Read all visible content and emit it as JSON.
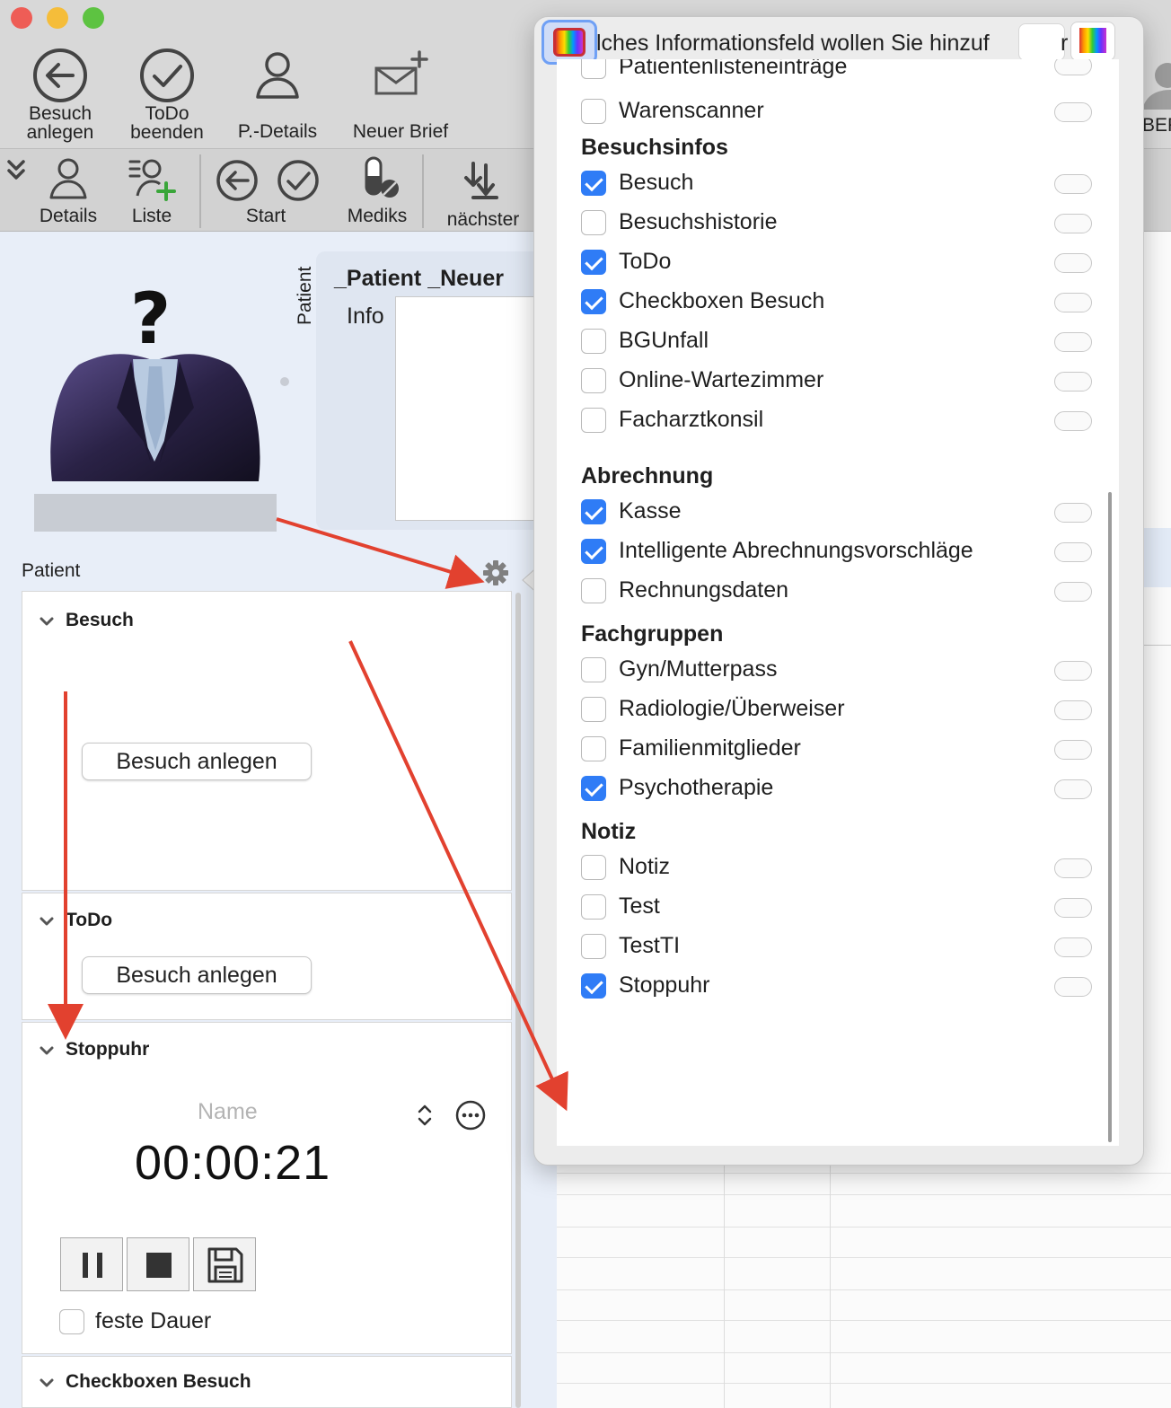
{
  "toolbar1": {
    "items": [
      {
        "label_line1": "Besuch",
        "label_line2": "anlegen"
      },
      {
        "label_line1": "ToDo",
        "label_line2": "beenden"
      },
      {
        "label": "P.-Details"
      },
      {
        "label": "Neuer Brief"
      }
    ],
    "right_partial_label": "BEF"
  },
  "toolbar2": {
    "items": [
      {
        "label": "Details"
      },
      {
        "label": "Liste"
      },
      {
        "label": "Start"
      },
      {
        "label": "Mediks"
      },
      {
        "label": "nächster"
      }
    ]
  },
  "patient_card": {
    "vertical_label": "Patient",
    "name": "_Patient _Neuer",
    "info_label": "Info"
  },
  "left": {
    "section_label": "Patient",
    "panels": {
      "besuch": {
        "title": "Besuch",
        "button": "Besuch anlegen"
      },
      "todo": {
        "title": "ToDo",
        "button": "Besuch anlegen"
      },
      "stoppuhr": {
        "title": "Stoppuhr",
        "name_placeholder": "Name",
        "time": "00:00:21",
        "fixed_duration_label": "feste Dauer"
      },
      "checkboxen": {
        "title": "Checkboxen Besuch"
      }
    }
  },
  "popover": {
    "title": "lches Informationsfeld wollen Sie hinzuf",
    "title_trailing": "r",
    "partial_top_item": "Patientenlisteneinträge",
    "top_items": [
      {
        "label": "Warenscanner",
        "checked": false
      }
    ],
    "groups": [
      {
        "header": "Besuchsinfos",
        "items": [
          {
            "label": "Besuch",
            "checked": true
          },
          {
            "label": "Besuchshistorie",
            "checked": false
          },
          {
            "label": "ToDo",
            "checked": true
          },
          {
            "label": "Checkboxen Besuch",
            "checked": true
          },
          {
            "label": "BGUnfall",
            "checked": false
          },
          {
            "label": "Online-Wartezimmer",
            "checked": false
          },
          {
            "label": "Facharztkonsil",
            "checked": false
          }
        ]
      },
      {
        "header": "Abrechnung",
        "items": [
          {
            "label": "Kasse",
            "checked": true
          },
          {
            "label": "Intelligente Abrechnungsvorschläge",
            "checked": true
          },
          {
            "label": "Rechnungsdaten",
            "checked": false
          }
        ]
      },
      {
        "header": "Fachgruppen",
        "items": [
          {
            "label": "Gyn/Mutterpass",
            "checked": false
          },
          {
            "label": "Radiologie/Überweiser",
            "checked": false
          },
          {
            "label": "Familienmitglieder",
            "checked": false
          },
          {
            "label": "Psychotherapie",
            "checked": true
          }
        ]
      },
      {
        "header": "Notiz",
        "items": [
          {
            "label": "Notiz",
            "checked": false
          },
          {
            "label": "Test",
            "checked": false
          },
          {
            "label": "TestTI",
            "checked": false
          },
          {
            "label": "Stoppuhr",
            "checked": true
          }
        ]
      }
    ]
  },
  "colors": {
    "accent_blue": "#2f7cf6",
    "annotation_red": "#e2412f"
  }
}
